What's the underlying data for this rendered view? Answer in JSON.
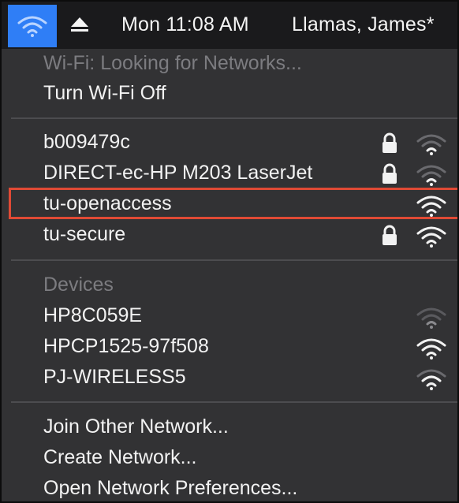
{
  "menubar": {
    "clock": "Mon 11:08 AM",
    "user": "Llamas, James*",
    "icons": [
      "wifi-icon",
      "eject-icon"
    ],
    "accent": "#2f7ef6"
  },
  "wifi_section": {
    "status": "Wi-Fi: Looking for Networks...",
    "toggle_label": "Turn Wi-Fi Off"
  },
  "networks": [
    {
      "name": "b009479c",
      "locked": true,
      "signal": "weak"
    },
    {
      "name": "DIRECT-ec-HP M203 LaserJet",
      "locked": true,
      "signal": "weak"
    },
    {
      "name": "tu-openaccess",
      "locked": false,
      "signal": "full",
      "highlighted": true
    },
    {
      "name": "tu-secure",
      "locked": true,
      "signal": "full"
    }
  ],
  "devices_section": {
    "header": "Devices",
    "items": [
      {
        "name": "HP8C059E",
        "signal": "faint"
      },
      {
        "name": "HPCP1525-97f508",
        "signal": "full"
      },
      {
        "name": "PJ-WIRELESS5",
        "signal": "full"
      }
    ]
  },
  "actions": {
    "join_other": "Join Other Network...",
    "create": "Create Network...",
    "preferences": "Open Network Preferences..."
  },
  "highlight_color": "#e04a35"
}
